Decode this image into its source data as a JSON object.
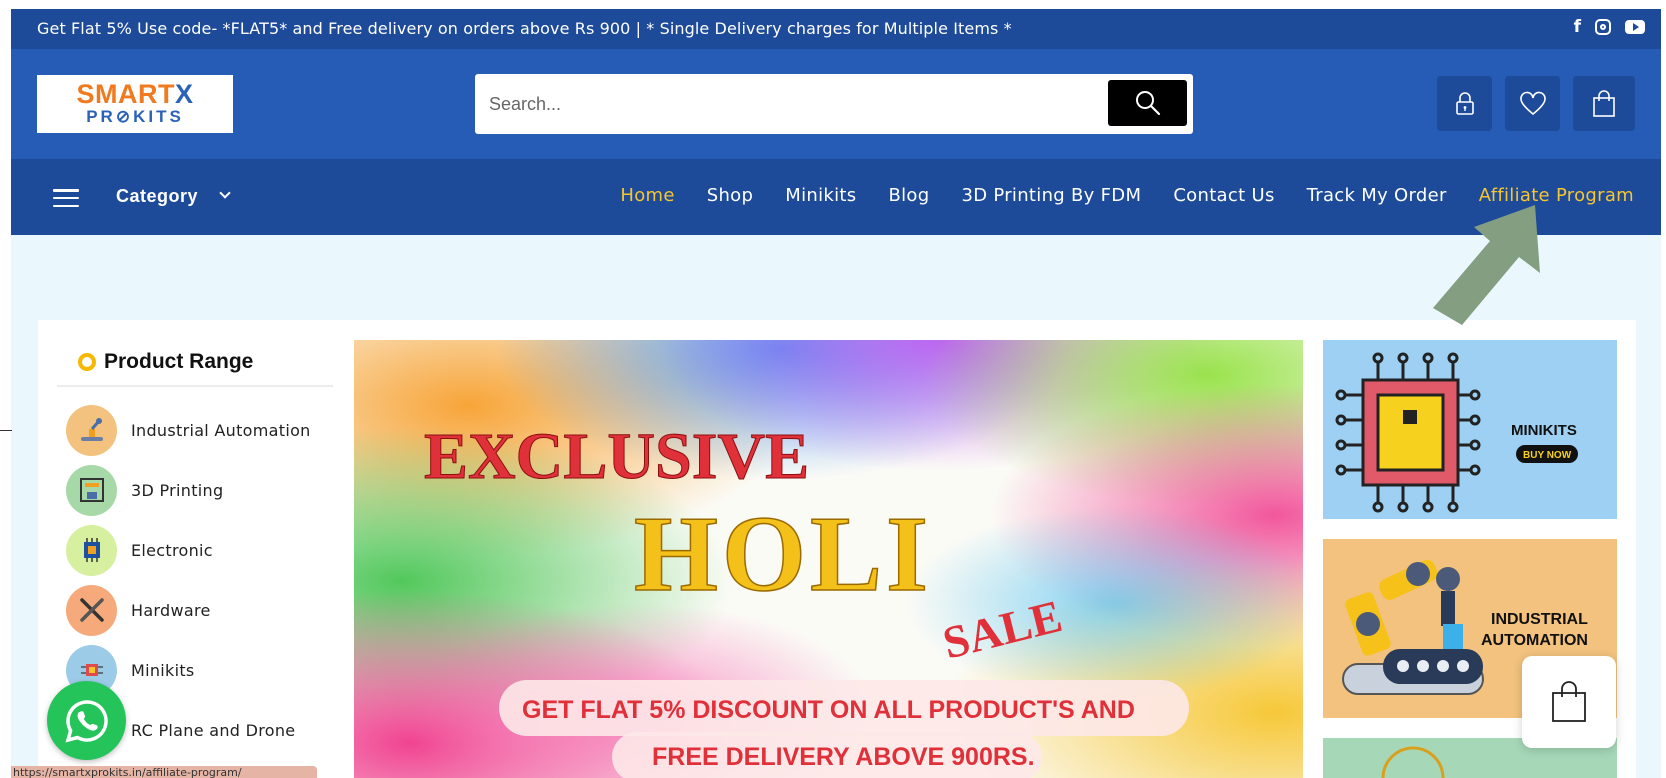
{
  "topbar": {
    "promo": "Get Flat 5% Use code- *FLAT5* and Free delivery on orders above Rs 900 | * Single Delivery charges for Multiple Items *",
    "social": {
      "facebook": "f"
    }
  },
  "header": {
    "logo": {
      "line1_a": "SMART",
      "line1_b": "X",
      "line2": "PR⊘KITS"
    },
    "search_placeholder": "Search..."
  },
  "nav": {
    "category": "Category",
    "items": [
      "Home",
      "Shop",
      "Minikits",
      "Blog",
      "3D Printing By FDM",
      "Contact Us",
      "Track My Order",
      "Affiliate Program"
    ]
  },
  "product_range": {
    "title": "Product Range",
    "items": [
      "Industrial Automation",
      "3D Printing",
      "Electronic",
      "Hardware",
      "Minikits",
      "RC Plane and Drone"
    ]
  },
  "banner": {
    "word1": "EXCLUSIVE",
    "word2": "HOLI",
    "word3": "SALE",
    "line1": "GET FLAT 5% DISCOUNT ON ALL PRODUCT'S AND",
    "line2": "FREE DELIVERY ABOVE 900RS."
  },
  "side_cards": {
    "minikits": {
      "title": "MINIKITS",
      "cta": "BUY NOW"
    },
    "industrial": {
      "line1": "INDUSTRIAL",
      "line2": "AUTOMATION"
    }
  },
  "status_url": "https://smartxprokits.in/affiliate-program/",
  "colors": {
    "topbar": "#1d4a99",
    "header": "#265cb6",
    "accent": "#f7c52e",
    "content_bg": "#eaf7fc"
  }
}
